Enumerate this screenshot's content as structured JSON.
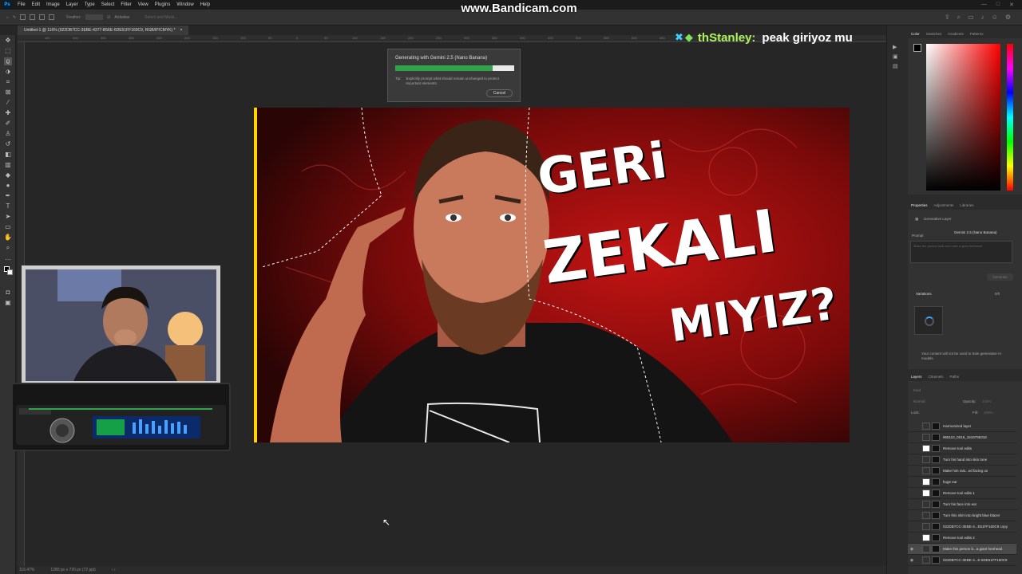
{
  "menubar": {
    "logo": "Ps",
    "items": [
      "File",
      "Edit",
      "Image",
      "Layer",
      "Type",
      "Select",
      "Filter",
      "View",
      "Plugins",
      "Window",
      "Help"
    ],
    "window_controls": [
      "—",
      "□",
      "✕"
    ]
  },
  "watermark": "www.Bandicam.com",
  "options_bar": {
    "antialias_label": "Antialias",
    "field_label": "Feather:",
    "mask_label": "Select and Mask..."
  },
  "document_tab": {
    "title": "Untitled-1 @ 116% (022DB7CC-3EBE-4377-B56E-6DE51FF160C9, RGB/8*/CMYK) *",
    "close": "×"
  },
  "ruler_ticks": [
    "450",
    "400",
    "350",
    "300",
    "250",
    "200",
    "150",
    "100",
    "50",
    "0",
    "50",
    "100",
    "150",
    "200",
    "250",
    "300",
    "350",
    "400",
    "450",
    "500",
    "550",
    "600",
    "650",
    "700",
    "750",
    "800",
    "850",
    "900"
  ],
  "progress": {
    "title": "Generating with Gemini 2.5 (Nano Banana)",
    "value": 0.82,
    "tip_label": "Tip:",
    "tip_text": "Explicitly prompt what should remain unchanged to protect important elements.",
    "cancel": "Cancel"
  },
  "thumbnail": {
    "line1": "GERi",
    "line2": "ZEKALI",
    "line3": "MIYIZ?"
  },
  "chat": {
    "emote1": "✖",
    "emote2": "◆",
    "user": "thStanley:",
    "message": "peak giriyoz mu"
  },
  "color_panel": {
    "tabs": [
      "Color",
      "Swatches",
      "Gradients",
      "Patterns"
    ]
  },
  "properties_panel": {
    "tabs": [
      "Properties",
      "Adjustments",
      "Libraries"
    ],
    "layer_type": "Generative Layer",
    "prompt_label": "Prompt",
    "model": "Gemini 2.5 (Nano Banana)",
    "prompt_placeholder": "Make the person look and raise a giant forehead",
    "generate": "Generate",
    "variations_label": "Variations",
    "variations_count": "0/0",
    "disclaimer": "Your content will not be used to train generative AI models."
  },
  "layers_panel": {
    "tabs": [
      "Layers",
      "Channels",
      "Paths"
    ],
    "search_placeholder": "Kind",
    "blend_mode": "Normal",
    "opacity_label": "Opacity:",
    "opacity_value": "100%",
    "lock_label": "Lock:",
    "fill_label": "Fill:",
    "fill_value": "100%",
    "layers": [
      {
        "name": "Harmonized layer",
        "visible": false,
        "dark": true
      },
      {
        "name": "965110_0019_1616796318",
        "visible": false,
        "dark": true
      },
      {
        "name": "Remove tool edits",
        "visible": false,
        "dark": false
      },
      {
        "name": "Turn his hand into skin tone",
        "visible": false,
        "dark": true
      },
      {
        "name": "Make him rais...ed facing us",
        "visible": false,
        "dark": true
      },
      {
        "name": "huge ear",
        "visible": false,
        "dark": false
      },
      {
        "name": "Remove tool edits 1",
        "visible": false,
        "dark": false
      },
      {
        "name": "Turn his face into ear",
        "visible": false,
        "dark": true
      },
      {
        "name": "Turn this shirt into bright blue blazer",
        "visible": false,
        "dark": true
      },
      {
        "name": "022DB7CC-3EBE-4...E51FF160C9 copy",
        "visible": false,
        "dark": true
      },
      {
        "name": "Remove tool edits 2",
        "visible": false,
        "dark": false
      },
      {
        "name": "Make this person b...a giant forehead",
        "visible": true,
        "dark": true,
        "selected": true
      },
      {
        "name": "022DB7CC-3EBE-4...E-6DE51FF160C9",
        "visible": true,
        "dark": true
      }
    ]
  },
  "statusbar": {
    "zoom": "116.47%",
    "doc_size": "1280 px x 720 px (72 ppi)",
    "nav": "‹ ›"
  }
}
